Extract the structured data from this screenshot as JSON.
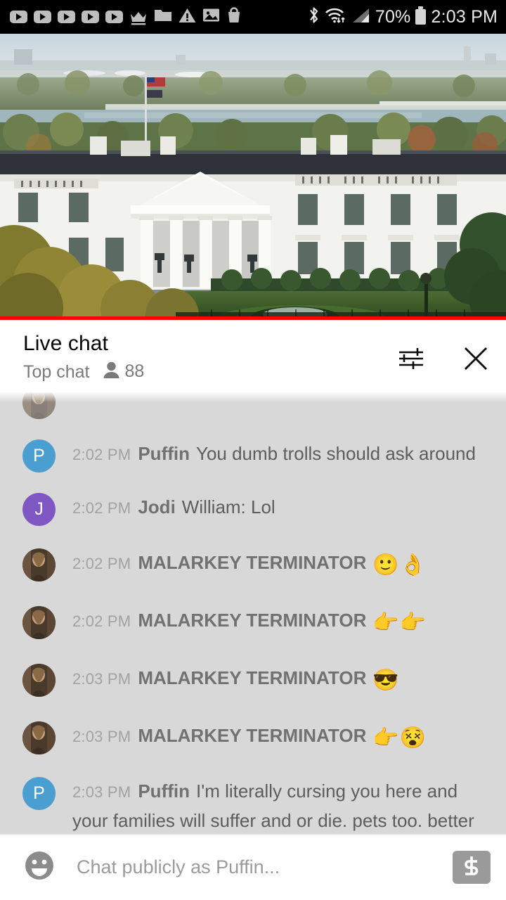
{
  "status_bar": {
    "notification_icons": [
      "youtube-play-icon",
      "youtube-play-icon",
      "youtube-play-icon",
      "youtube-play-icon",
      "youtube-play-icon",
      "crown-icon",
      "folder-icon",
      "warning-triangle-icon",
      "image-icon",
      "shopping-bag-icon"
    ],
    "bluetooth_icon": "bluetooth-icon",
    "wifi_icon": "wifi-icon",
    "signal_icon": "cellular-signal-icon",
    "battery_percent": "70%",
    "battery_icon": "battery-icon",
    "clock": "2:03 PM"
  },
  "video": {
    "alt": "White House live stream",
    "progress_percent": 100,
    "progress_color": "#ff0000"
  },
  "chat_header": {
    "title": "Live chat",
    "subtitle": "Top chat",
    "viewer_icon": "person-icon",
    "viewer_count": "88",
    "settings_icon": "sliders-icon",
    "close_icon": "close-icon"
  },
  "messages": [
    {
      "id": "partial-top",
      "timestamp": "",
      "author": "",
      "text": "",
      "emoji": "",
      "avatar_type": "photo",
      "avatar_letter": "",
      "avatar_color": "#5b4636",
      "partial": true
    },
    {
      "id": "m1",
      "timestamp": "2:02 PM",
      "author": "Puffin",
      "text": "You dumb trolls should ask around",
      "emoji": "",
      "avatar_type": "letter",
      "avatar_letter": "P",
      "avatar_color": "#4a9fd0",
      "partial": false
    },
    {
      "id": "m2",
      "timestamp": "2:02 PM",
      "author": "Jodi",
      "text": "William: Lol",
      "emoji": "",
      "avatar_type": "letter",
      "avatar_letter": "J",
      "avatar_color": "#7e57c2",
      "partial": false
    },
    {
      "id": "m3",
      "timestamp": "2:02 PM",
      "author": "MALARKEY TERMINATOR",
      "text": "",
      "emoji": "🙂👌",
      "avatar_type": "photo",
      "avatar_letter": "",
      "avatar_color": "#5b4636",
      "partial": false
    },
    {
      "id": "m4",
      "timestamp": "2:02 PM",
      "author": "MALARKEY TERMINATOR",
      "text": "",
      "emoji": "👉👉",
      "avatar_type": "photo",
      "avatar_letter": "",
      "avatar_color": "#5b4636",
      "partial": false
    },
    {
      "id": "m5",
      "timestamp": "2:03 PM",
      "author": "MALARKEY TERMINATOR",
      "text": "",
      "emoji": "😎",
      "avatar_type": "photo",
      "avatar_letter": "",
      "avatar_color": "#5b4636",
      "partial": false
    },
    {
      "id": "m6",
      "timestamp": "2:03 PM",
      "author": "MALARKEY TERMINATOR",
      "text": "",
      "emoji": "👉😵",
      "avatar_type": "photo",
      "avatar_letter": "",
      "avatar_color": "#5b4636",
      "partial": false
    },
    {
      "id": "m7",
      "timestamp": "2:03 PM",
      "author": "Puffin",
      "text": "I'm literally cursing you here and your families will suffer and or die. pets too. better than living with YOU trumputineers",
      "emoji": "",
      "avatar_type": "letter",
      "avatar_letter": "P",
      "avatar_color": "#4a9fd0",
      "partial": false
    }
  ],
  "input_bar": {
    "emoji_icon": "emoji-smiley-icon",
    "placeholder": "Chat publicly as Puffin...",
    "value": "",
    "superchat_icon": "dollar-icon"
  },
  "colors": {
    "accent_red": "#ff0000",
    "chat_bg": "#d8d8d8",
    "header_bg": "#ffffff",
    "text_primary": "#030303",
    "text_secondary": "#7a7a7a",
    "author": "#717171",
    "message": "#5d5d5d",
    "timestamp": "#a2a2a2"
  }
}
